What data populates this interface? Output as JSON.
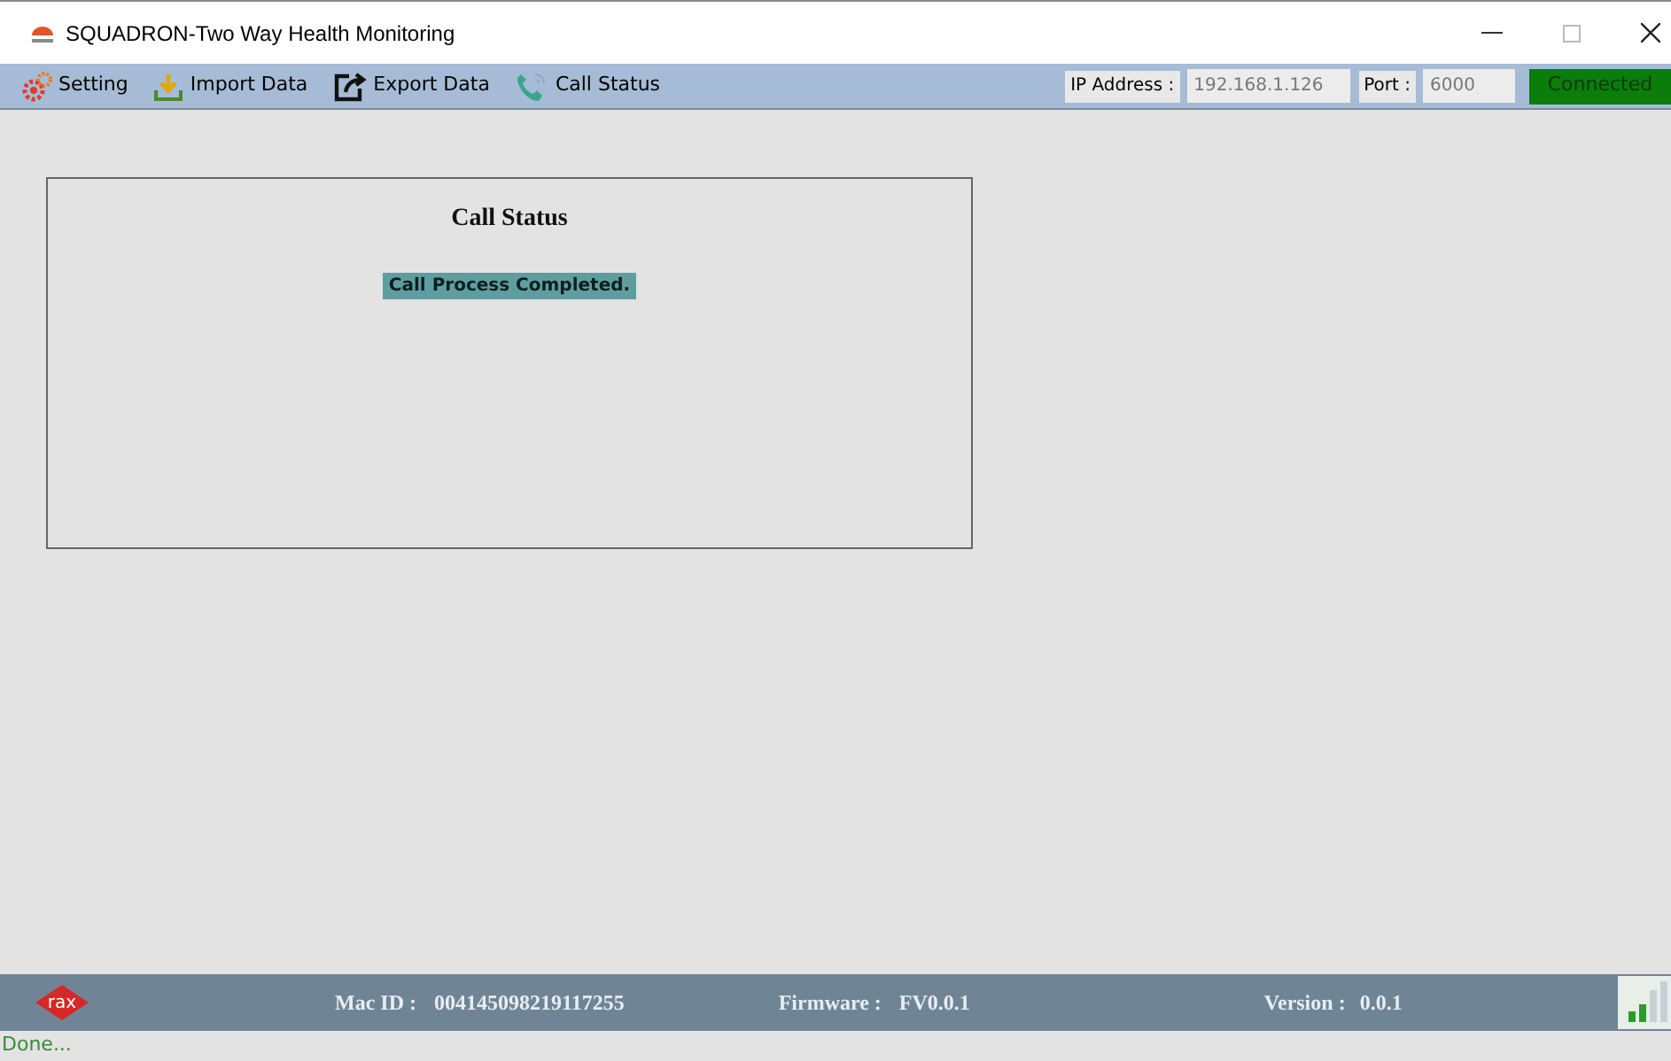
{
  "window": {
    "title": "SQUADRON-Two Way Health Monitoring"
  },
  "toolbar": {
    "items": [
      {
        "kind": "setting",
        "label": "Setting"
      },
      {
        "kind": "import",
        "label": "Import Data"
      },
      {
        "kind": "export",
        "label": "Export Data"
      },
      {
        "kind": "call",
        "label": "Call Status"
      }
    ],
    "ip_label": "IP Address :",
    "ip_value": "192.168.1.126",
    "port_label": "Port :",
    "port_value": "6000",
    "connection": {
      "label": "Connected",
      "connected": true
    }
  },
  "panel": {
    "title": "Call Status",
    "message": "Call Process Completed."
  },
  "footer": {
    "logo": "rax",
    "mac_label": "Mac ID :",
    "mac_value": "004145098219117255",
    "firmware_label": "Firmware :",
    "firmware_value": "FV0.0.1",
    "version_label": "Version :",
    "version_value": "0.0.1"
  },
  "status_bar": {
    "text": "Done..."
  }
}
